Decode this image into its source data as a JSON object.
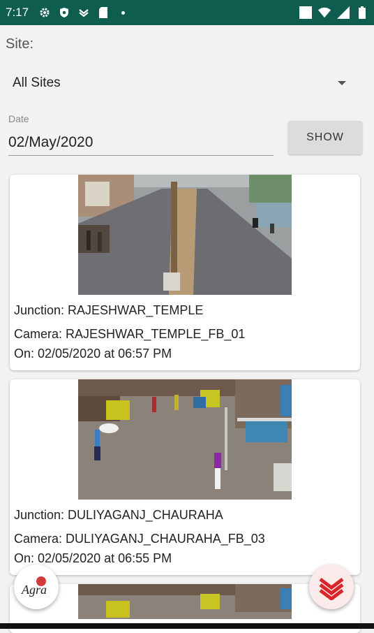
{
  "status_bar": {
    "time": "7:17",
    "left_icons": [
      "gear-icon",
      "shield-icon",
      "layers-icon",
      "sim-card-icon",
      "dot-icon"
    ],
    "right_icons": [
      "square-icon",
      "wifi-icon",
      "signal-icon",
      "battery-icon"
    ],
    "color": "#0f5d4f"
  },
  "filters": {
    "site_label": "Site:",
    "site_value": "All Sites",
    "date_label": "Date",
    "date_value": "02/May/2020",
    "show_label": "SHOW"
  },
  "cards": [
    {
      "junction": "Junction: RAJESHWAR_TEMPLE",
      "camera": "Camera: RAJESHWAR_TEMPLE_FB_01",
      "on": "On: 02/05/2020 at 06:57 PM"
    },
    {
      "junction": "Junction: DULIYAGANJ_CHAURAHA",
      "camera": "Camera: DULIYAGANJ_CHAURAHA_FB_03",
      "on": "On: 02/05/2020 at 06:55 PM"
    }
  ],
  "fabs": {
    "left_logo_text": "Agra",
    "right_icon": "layers-red-icon"
  }
}
